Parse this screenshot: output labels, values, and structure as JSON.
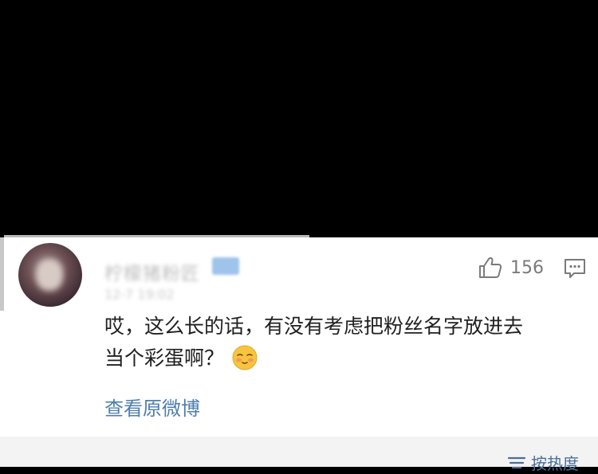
{
  "comment": {
    "username": "柠檬猪粉匠",
    "timestamp": "12-7 19:02",
    "likes": "156",
    "text_line1": "哎，这么长的话，有没有考虑把粉丝名字放进去",
    "text_line2": "当个彩蛋啊？",
    "view_original": "查看原微博"
  },
  "sort": {
    "label": "按热度"
  },
  "icons": {
    "like": "thumbs-up-icon",
    "comment": "comment-bubble-icon",
    "emoji": "shy-face-emoji-icon",
    "sort": "sort-lines-icon"
  },
  "colors": {
    "link": "#507daf",
    "badge": "#9ec4ec",
    "text": "#1f1f1f"
  }
}
